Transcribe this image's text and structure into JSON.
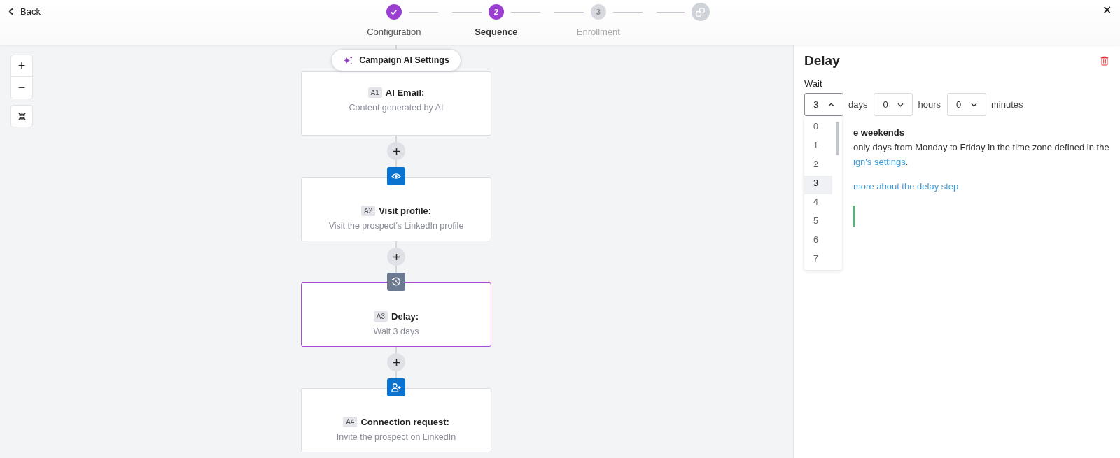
{
  "header": {
    "back": "Back",
    "steps": [
      {
        "kind": "done",
        "label": "Configuration",
        "selected": false
      },
      {
        "kind": "current",
        "number": "2",
        "label": "Sequence",
        "selected": true
      },
      {
        "kind": "upcoming",
        "number": "3",
        "label": "Enrollment",
        "selected": false
      },
      {
        "kind": "final"
      }
    ],
    "close": "✕"
  },
  "zoom_controls": [
    {
      "kind": "zoom-in",
      "label": "+"
    },
    {
      "kind": "zoom-out",
      "label": "−"
    },
    {
      "kind": "fit"
    }
  ],
  "ai_settings": {
    "label": "Campaign AI Settings"
  },
  "nodes": [
    {
      "kind": "email",
      "tag": "A1",
      "title": "AI Email:",
      "subtitle": "Content generated by AI",
      "selected": false
    },
    {
      "kind": "visit",
      "tag": "A2",
      "title": "Visit profile:",
      "subtitle": "Visit the prospect’s LinkedIn profile",
      "selected": false
    },
    {
      "kind": "delay",
      "tag": "A3",
      "title": "Delay:",
      "subtitle": "Wait 3 days",
      "selected": true
    },
    {
      "kind": "connect",
      "tag": "A4",
      "title": "Connection request:",
      "subtitle": "Invite the prospect on LinkedIn",
      "selected": false
    }
  ],
  "panel": {
    "title": "Delay",
    "wait_label": "Wait",
    "fields": [
      {
        "value": "3",
        "unit": "days",
        "expanded": true
      },
      {
        "value": "0",
        "unit": "hours",
        "expanded": false
      },
      {
        "value": "0",
        "unit": "minutes",
        "expanded": false
      }
    ],
    "options": [
      {
        "label": "0",
        "selected": false
      },
      {
        "label": "1",
        "selected": false
      },
      {
        "label": "2",
        "selected": false
      },
      {
        "label": "3",
        "selected": true
      },
      {
        "label": "4",
        "selected": false
      },
      {
        "label": "5",
        "selected": false
      },
      {
        "label": "6",
        "selected": false
      },
      {
        "label": "7",
        "selected": false
      }
    ],
    "weekends_title": "e weekends",
    "weekends_text": "only days from Monday to Friday in the time zone defined in the",
    "settings_link": "ign's settings",
    "settings_end": ".",
    "learn_link": "more about the delay step"
  }
}
